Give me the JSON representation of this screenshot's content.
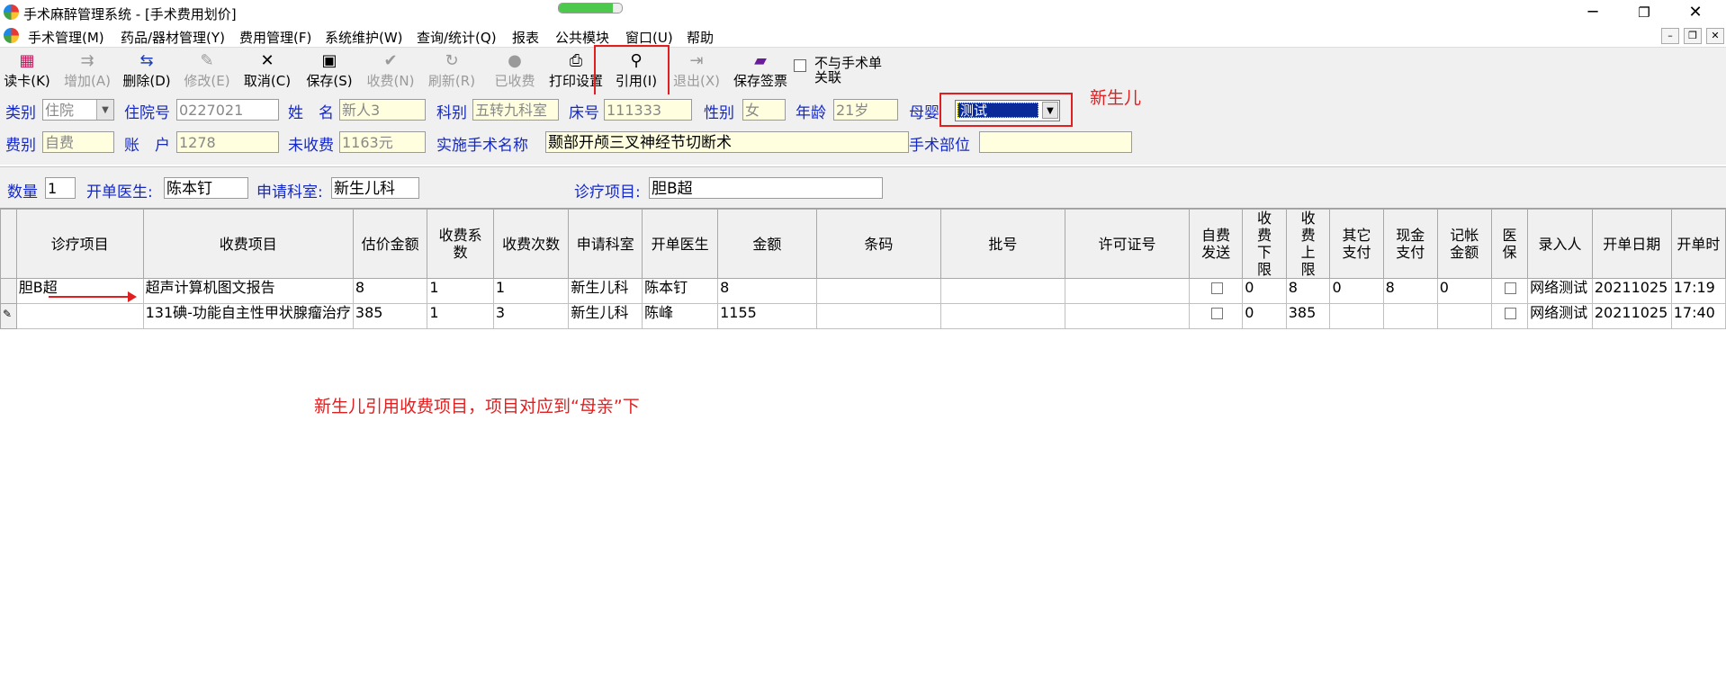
{
  "window": {
    "title": "手术麻醉管理系统 - [手术费用划价]",
    "progress": 0.85
  },
  "menu": [
    "手术管理(M)",
    "药品/器材管理(Y)",
    "费用管理(F)",
    "系统维护(W)",
    "查询/统计(Q)",
    "报表",
    "公共模块",
    "窗口(U)",
    "帮助"
  ],
  "toolbar": {
    "read_card": "读卡(K)",
    "add": "增加(A)",
    "delete": "删除(D)",
    "modify": "修改(E)",
    "cancel": "取消(C)",
    "save": "保存(S)",
    "charge": "收费(N)",
    "refresh": "刷新(R)",
    "charged": "已收费",
    "print_setup": "打印设置",
    "quote": "引用(I)",
    "exit": "退出(X)",
    "save_sign": "保存签票",
    "not_link_line1": "不与手术单",
    "not_link_line2": "关联"
  },
  "form": {
    "category_label": "类别",
    "category_value": "住院",
    "admission_label": "住院号",
    "admission_value": "0227021",
    "name_label": "姓　名",
    "name_value": "新人3",
    "dept_label": "科别",
    "dept_value": "五转九科室",
    "bed_label": "床号",
    "bed_value": "111333",
    "sex_label": "性别",
    "sex_value": "女",
    "age_label": "年龄",
    "age_value": "21岁",
    "mother_baby_label": "母婴",
    "mother_baby_value": "测试",
    "fee_type_label": "费别",
    "fee_type_value": "自费",
    "account_label": "账　户",
    "account_value": "1278",
    "uncharged_label": "未收费",
    "uncharged_value": "1163元",
    "surgery_name_label": "实施手术名称",
    "surgery_name_value": "颞部开颅三叉神经节切断术",
    "surgery_site_label": "手术部位",
    "surgery_site_value": "",
    "quantity_label": "数量",
    "quantity_value": "1",
    "doctor_label": "开单医生:",
    "doctor_value": "陈本钉",
    "req_dept_label": "申请科室:",
    "req_dept_value": "新生儿科",
    "diag_item_label": "诊疗项目:",
    "diag_item_value": "胆B超"
  },
  "annotations": {
    "newborn": "新生儿",
    "note": "新生儿引用收费项目，项目对应到“母亲”下"
  },
  "table": {
    "headers": [
      "诊疗项目",
      "收费项目",
      "估价金额",
      "收费系数",
      "收费次数",
      "申请科室",
      "开单医生",
      "金额",
      "条码",
      "批号",
      "许可证号",
      "自费发送",
      "收费下限",
      "收费上限",
      "其它支付",
      "现金支付",
      "记帐金额",
      "医保",
      "录入人",
      "开单日期",
      "开单时"
    ],
    "rows": [
      {
        "diag": "胆B超",
        "fee_item": "超声计算机图文报告",
        "est": "8",
        "coef": "1",
        "times": "1",
        "dept": "新生儿科",
        "doctor": "陈本钉",
        "amount": "8",
        "barcode": "",
        "batch": "",
        "license": "",
        "lower": "0",
        "upper": "8",
        "other": "0",
        "cash": "8",
        "account": "0",
        "entry": "网络测试",
        "date": "20211025",
        "time": "17:19"
      },
      {
        "diag": "",
        "fee_item": "131碘-功能自主性甲状腺瘤治疗",
        "est": "385",
        "coef": "1",
        "times": "3",
        "dept": "新生儿科",
        "doctor": "陈峰",
        "amount": "1155",
        "barcode": "",
        "batch": "",
        "license": "",
        "lower": "0",
        "upper": "385",
        "other": "",
        "cash": "",
        "account": "",
        "entry": "网络测试",
        "date": "20211025",
        "time": "17:40"
      }
    ]
  }
}
